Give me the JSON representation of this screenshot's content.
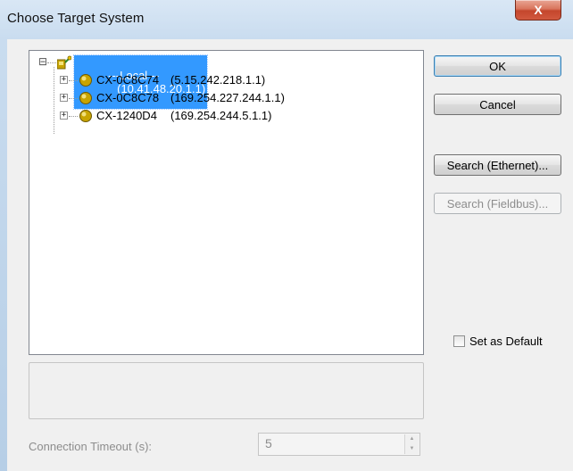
{
  "window": {
    "title": "Choose Target System",
    "close_label": "X"
  },
  "tree": {
    "root": {
      "name": "---Local---",
      "address": "(10.41.48.20.1.1)",
      "expander": "⊟"
    },
    "children": [
      {
        "name": "CX-0C8C74",
        "address": "(5.15.242.218.1.1)",
        "expander": "+"
      },
      {
        "name": "CX-0C8C78",
        "address": "(169.254.227.244.1.1)",
        "expander": "+"
      },
      {
        "name": "CX-1240D4",
        "address": "(169.254.244.5.1.1)",
        "expander": "+"
      }
    ]
  },
  "buttons": {
    "ok": "OK",
    "cancel": "Cancel",
    "search_ethernet": "Search (Ethernet)...",
    "search_fieldbus": "Search (Fieldbus)..."
  },
  "set_default": {
    "label": "Set as Default",
    "checked": false
  },
  "timeout": {
    "label": "Connection Timeout (s):",
    "value": "5"
  },
  "colors": {
    "selection": "#3399ff",
    "node_icon": "#c8a400"
  }
}
